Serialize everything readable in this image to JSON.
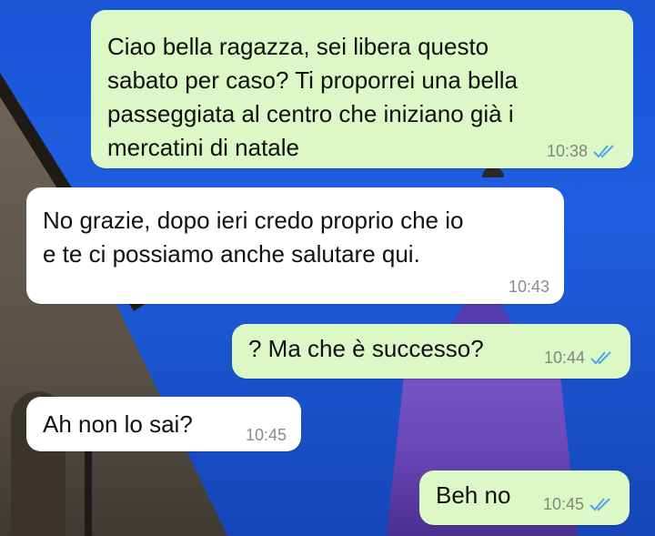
{
  "chat": {
    "messages": [
      {
        "direction": "outgoing",
        "text": "Ciao bella ragazza, sei libera questo\nsabato per caso? Ti proporrei una bella\npasseggiata al centro che iniziano già i\nmercatini di natale",
        "time": "10:38",
        "status_icon": "double-check-read-icon"
      },
      {
        "direction": "incoming",
        "text": "No grazie, dopo ieri credo proprio che io\ne te ci possiamo anche salutare qui.",
        "time": "10:43"
      },
      {
        "direction": "outgoing",
        "text": "? Ma che è successo?",
        "time": "10:44",
        "status_icon": "double-check-read-icon"
      },
      {
        "direction": "incoming",
        "text": "Ah non lo sai?",
        "time": "10:45"
      },
      {
        "direction": "outgoing",
        "text": "Beh no",
        "time": "10:45",
        "status_icon": "double-check-read-icon"
      }
    ]
  },
  "colors": {
    "outgoing_bubble": "#dcf8c6",
    "incoming_bubble": "#ffffff",
    "read_ticks": "#4fa6e6",
    "wallpaper_sky": "#1f5ee0"
  }
}
